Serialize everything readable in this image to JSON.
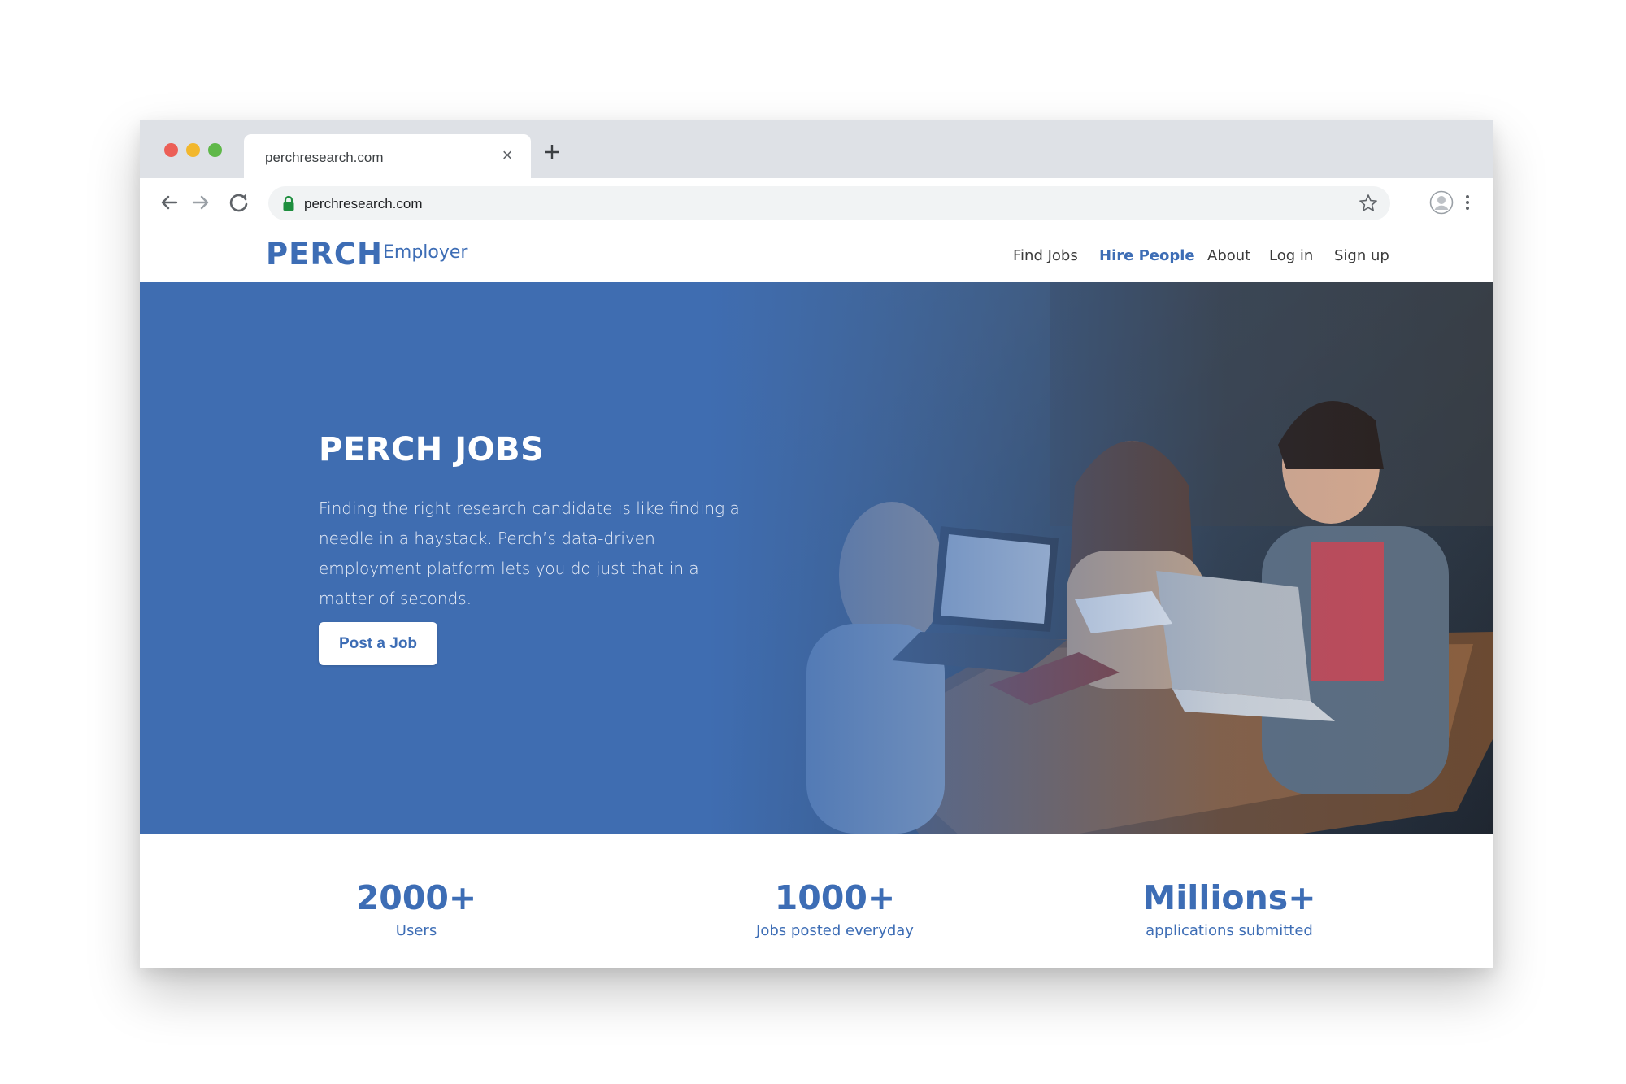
{
  "browser": {
    "tab_title": "perchresearch.com",
    "tab_close": "×",
    "url": "perchresearch.com",
    "icons": [
      "close-icon",
      "plus-icon",
      "back-arrow-icon",
      "forward-arrow-icon",
      "reload-icon",
      "lock-icon",
      "star-icon",
      "profile-icon",
      "kebab-menu-icon"
    ]
  },
  "site": {
    "logo": "PERCH",
    "logo_sub": "Employer",
    "nav": [
      {
        "label": "Find Jobs",
        "active": false
      },
      {
        "label": "Hire People",
        "active": true
      },
      {
        "label": "About",
        "active": false
      },
      {
        "label": "Log in",
        "active": false
      },
      {
        "label": "Sign up",
        "active": false
      }
    ]
  },
  "hero": {
    "title": "PERCH JOBS",
    "description": "Finding the right research candidate is like finding a needle in a haystack. Perch’s data-driven employment platform lets you do just that in a matter of seconds.",
    "cta": "Post a Job"
  },
  "stats": [
    {
      "value": "2000+",
      "label": "Users"
    },
    {
      "value": "1000+",
      "label": "Jobs posted everyday"
    },
    {
      "value": "Millions+",
      "label": "applications submitted"
    }
  ],
  "colors": {
    "brand": "#3d6db5",
    "hero_bg": "#3f6db1",
    "tabstrip": "#dee1e6",
    "omnibox": "#f1f3f4"
  }
}
